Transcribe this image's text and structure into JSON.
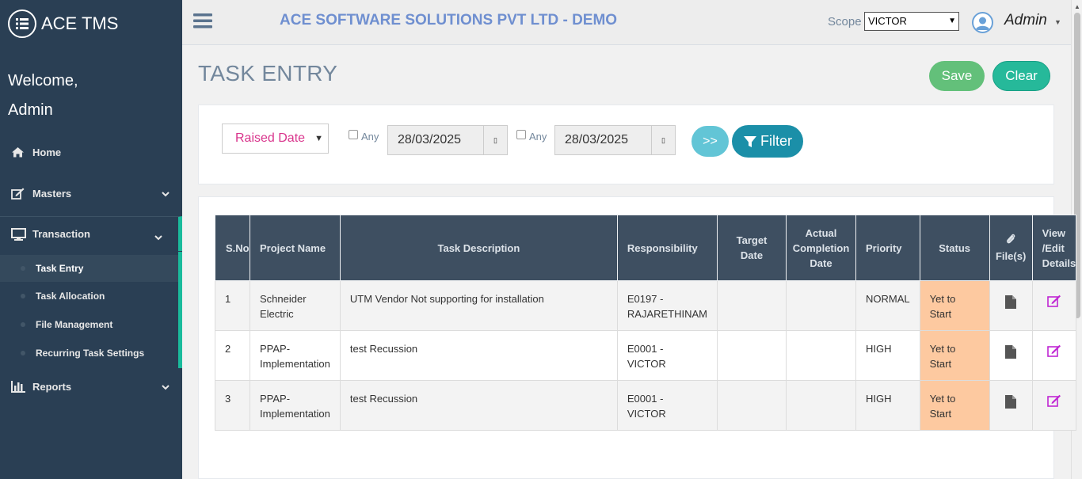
{
  "sidebar": {
    "brand": "ACE TMS",
    "welcome_line1": "Welcome,",
    "welcome_line2": "Admin",
    "items": [
      {
        "label": "Home"
      },
      {
        "label": "Masters"
      },
      {
        "label": "Transaction"
      },
      {
        "label": "Reports"
      }
    ],
    "sub_items": [
      {
        "label": "Task Entry"
      },
      {
        "label": "Task Allocation"
      },
      {
        "label": "File Management"
      },
      {
        "label": "Recurring Task Settings"
      }
    ]
  },
  "topbar": {
    "company": "ACE SOFTWARE SOLUTIONS PVT LTD - DEMO",
    "scope_label": "Scope",
    "scope_value": "VICTOR",
    "user": "Admin"
  },
  "page": {
    "title": "TASK ENTRY",
    "save_label": "Save",
    "clear_label": "Clear"
  },
  "filter": {
    "date_type": "Raised Date",
    "any_label": "Any",
    "from_date": "28/03/2025",
    "to_date": "28/03/2025",
    "go_label": ">>",
    "filter_label": "Filter"
  },
  "table": {
    "headers": {
      "sno": "S.No",
      "project": "Project Name",
      "desc": "Task Description",
      "resp": "Responsibility",
      "target1": "Target",
      "target2": "Date",
      "actual1": "Actual",
      "actual2": "Completion",
      "actual3": "Date",
      "priority": "Priority",
      "status": "Status",
      "files": "File(s)",
      "view1": "View",
      "view2": "/Edit",
      "view3": "Details"
    },
    "rows": [
      {
        "sno": "1",
        "project1": "Schneider",
        "project2": "Electric",
        "desc": "UTM Vendor Not supporting for installation",
        "resp1": "E0197 -",
        "resp2": "RAJARETHINAM",
        "priority": "NORMAL",
        "status1": "Yet to",
        "status2": "Start"
      },
      {
        "sno": "2",
        "project1": "PPAP-",
        "project2": "Implementation",
        "desc": "test Recussion",
        "resp1": "E0001 -",
        "resp2": "VICTOR",
        "priority": "HIGH",
        "status1": "Yet to",
        "status2": "Start"
      },
      {
        "sno": "3",
        "project1": "PPAP-",
        "project2": "Implementation",
        "desc": "test Recussion",
        "resp1": "E0001 -",
        "resp2": "VICTOR",
        "priority": "HIGH",
        "status1": "Yet to",
        "status2": "Start"
      }
    ]
  },
  "colors": {
    "sidebar_bg": "#2a3f54",
    "accent": "#1abb9c",
    "status_bg": "#fdc9a0",
    "edit_icon": "#c026d3"
  }
}
